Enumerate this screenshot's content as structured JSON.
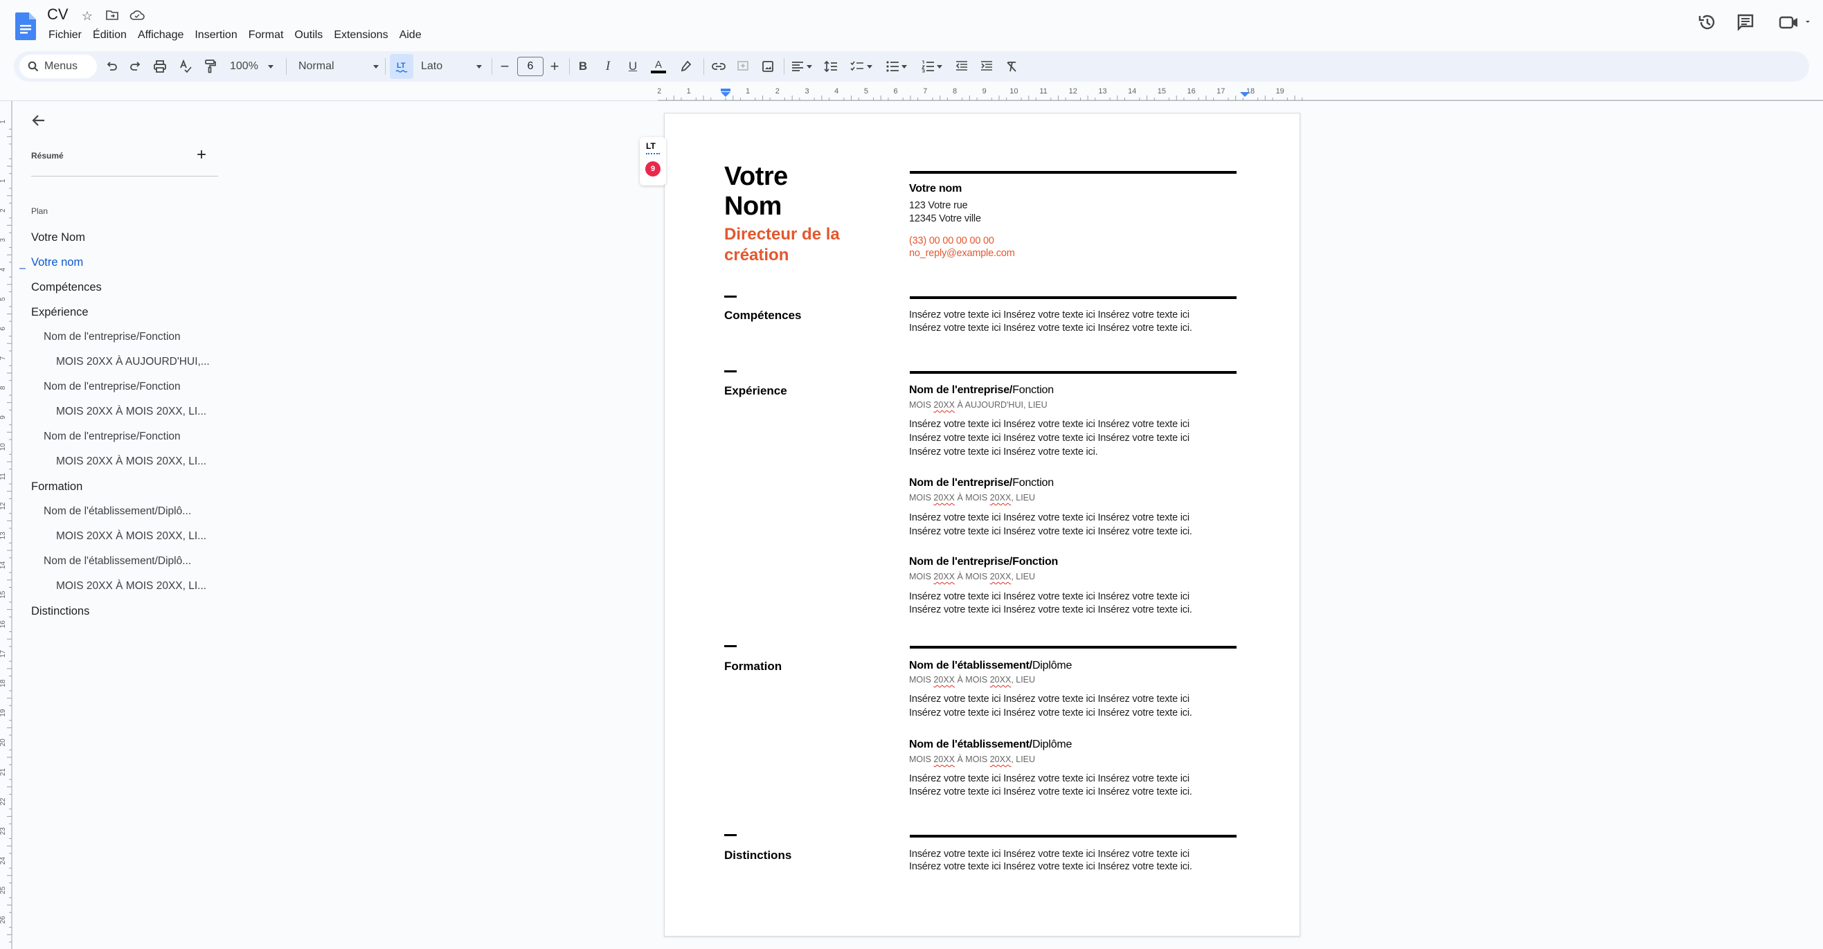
{
  "header": {
    "doc_title": "CV",
    "menus": [
      "Fichier",
      "Édition",
      "Affichage",
      "Insertion",
      "Format",
      "Outils",
      "Extensions",
      "Aide"
    ]
  },
  "toolbar": {
    "search_label": "Menus",
    "zoom": "100%",
    "style": "Normal",
    "font": "Lato",
    "font_size": "6"
  },
  "ruler": {
    "horizontal_ticks": [
      "2",
      "1",
      "",
      "1",
      "2",
      "3",
      "4",
      "5",
      "6",
      "7",
      "8",
      "9",
      "10",
      "11",
      "12",
      "13",
      "14",
      "15",
      "16",
      "17",
      "18",
      "19"
    ],
    "vertical_ticks": [
      "1",
      "",
      "1",
      "2",
      "3",
      "4",
      "5",
      "6",
      "7",
      "8",
      "9",
      "10",
      "11",
      "12",
      "13",
      "14",
      "15",
      "16",
      "17",
      "18",
      "19",
      "20",
      "21",
      "22",
      "23",
      "24",
      "25",
      "26"
    ]
  },
  "sidebar": {
    "summary_label": "Résumé",
    "plan_label": "Plan",
    "outline": [
      {
        "label": "Votre Nom",
        "level": 1,
        "active": false
      },
      {
        "label": "Votre nom",
        "level": 1,
        "active": true
      },
      {
        "label": "Compétences",
        "level": 1,
        "active": false
      },
      {
        "label": "Expérience",
        "level": 1,
        "active": false
      },
      {
        "label": "Nom de l'entreprise/Fonction",
        "level": 2,
        "active": false
      },
      {
        "label": "MOIS 20XX À AUJOURD'HUI,...",
        "level": 3,
        "active": false
      },
      {
        "label": "Nom de l'entreprise/Fonction",
        "level": 2,
        "active": false
      },
      {
        "label": "MOIS 20XX À MOIS 20XX, LI...",
        "level": 3,
        "active": false
      },
      {
        "label": "Nom de l'entreprise/Fonction",
        "level": 2,
        "active": false
      },
      {
        "label": "MOIS 20XX À MOIS 20XX, LI...",
        "level": 3,
        "active": false
      },
      {
        "label": "Formation",
        "level": 1,
        "active": false
      },
      {
        "label": "Nom de l'établissement/Diplô...",
        "level": 2,
        "active": false
      },
      {
        "label": "MOIS 20XX À MOIS 20XX, LI...",
        "level": 3,
        "active": false
      },
      {
        "label": "Nom de l'établissement/Diplô...",
        "level": 2,
        "active": false
      },
      {
        "label": "MOIS 20XX À MOIS 20XX, LI...",
        "level": 3,
        "active": false
      },
      {
        "label": "Distinctions",
        "level": 1,
        "active": false
      }
    ]
  },
  "lt_widget": {
    "label": "LT",
    "badge_count": "9"
  },
  "document": {
    "name_line1": "Votre",
    "name_line2": "Nom",
    "title_line1": "Directeur de la",
    "title_line2": "création",
    "contact": {
      "name": "Votre nom",
      "street": "123 Votre rue",
      "city": "12345 Votre ville",
      "phone": "(33) 00 00 00 00 00",
      "email": "no_reply@example.com"
    },
    "placeholder_line1": "Insérez votre texte ici Insérez votre texte ici Insérez votre texte ici",
    "placeholder_line2": "Insérez votre texte ici Insérez votre texte ici Insérez votre texte ici.",
    "placeholder_line2b": "Insérez votre texte ici Insérez votre texte ici Insérez votre texte ici",
    "placeholder_line3": "Insérez votre texte ici Insérez votre texte ici.",
    "sections": {
      "skills": "Compétences",
      "experience": "Expérience",
      "education": "Formation",
      "awards": "Distinctions"
    },
    "experience": [
      {
        "company": "Nom de l'entreprise/",
        "role": "Fonction",
        "date_a": "MOIS ",
        "date_b": "20XX",
        "date_c": " À AUJOURD'HUI, LIEU",
        "date_d": "",
        "date_e": ""
      },
      {
        "company": "Nom de l'entreprise/",
        "role": "Fonction",
        "date_a": "MOIS ",
        "date_b": "20XX",
        "date_c": " À MOIS ",
        "date_d": "20XX",
        "date_e": ", LIEU"
      },
      {
        "company": "Nom de l'entreprise/Fonction",
        "role": "",
        "date_a": "MOIS ",
        "date_b": "20XX",
        "date_c": " À MOIS ",
        "date_d": "20XX",
        "date_e": ", LIEU"
      }
    ],
    "education": [
      {
        "school": "Nom de l'établissement/",
        "degree": "Diplôme",
        "date_a": "MOIS ",
        "date_b": "20XX",
        "date_c": " À MOIS ",
        "date_d": "20XX",
        "date_e": ", LIEU"
      },
      {
        "school": "Nom de l'établissement/",
        "degree": "Diplôme",
        "date_a": "MOIS ",
        "date_b": "20XX",
        "date_c": " À MOIS ",
        "date_d": "20XX",
        "date_e": ", LIEU"
      }
    ]
  },
  "colors": {
    "accent_orange": "#e4572e",
    "active_blue": "#0b57d0",
    "toolbar_bg": "#edf2fa"
  }
}
